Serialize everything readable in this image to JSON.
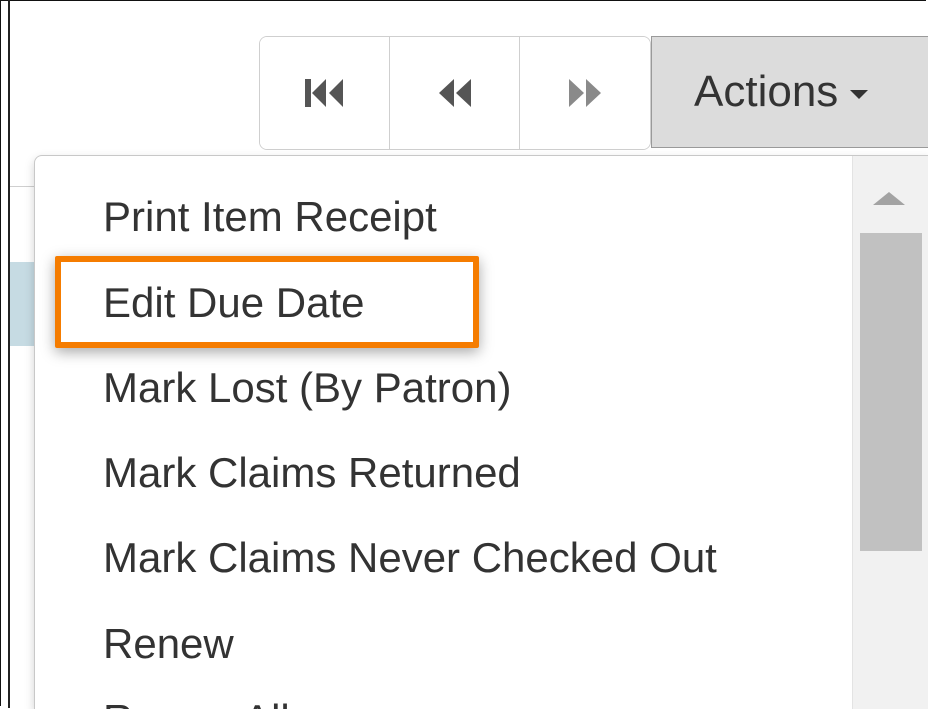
{
  "toolbar": {
    "actions_label": "Actions"
  },
  "menu": {
    "items": [
      {
        "label": "Print Item Receipt"
      },
      {
        "label": "Edit Due Date"
      },
      {
        "label": "Mark Lost (By Patron)"
      },
      {
        "label": "Mark Claims Returned"
      },
      {
        "label": "Mark Claims Never Checked Out"
      },
      {
        "label": "Renew"
      },
      {
        "label": "Renew All"
      }
    ]
  },
  "colors": {
    "highlight_border": "#f57c00",
    "actions_bg": "#dcdcdc",
    "selected_row_bg": "#c6dbe3"
  },
  "icons": {
    "first": "skip-first-icon",
    "prev": "rewind-icon",
    "next": "fast-forward-icon",
    "caret": "caret-down-icon"
  }
}
